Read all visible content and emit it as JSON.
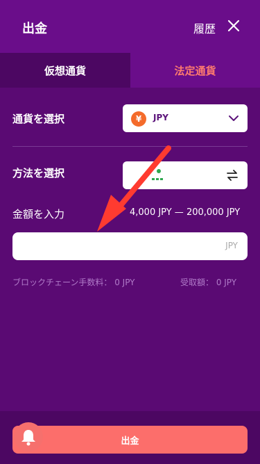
{
  "header": {
    "title": "出金",
    "history_label": "履歴"
  },
  "tabs": [
    {
      "label": "仮想通貨",
      "active": true
    },
    {
      "label": "法定通貨",
      "active": false
    }
  ],
  "currency": {
    "label": "通貨を選択",
    "selected": "JPY",
    "symbol": "¥"
  },
  "method": {
    "label": "方法を選択"
  },
  "amount": {
    "label": "金額を入力",
    "range": "4,000 JPY — 200,000 JPY",
    "unit": "JPY",
    "value": ""
  },
  "fees": {
    "blockchain_fee": "ブロックチェーン手数料： 0 JPY",
    "received": "受取額： 0 JPY"
  },
  "actions": {
    "withdraw_label": "出金"
  },
  "colors": {
    "background": "#5a0a73",
    "header": "#6a0d8a",
    "accent": "#fc6e6b",
    "tab_active_text": "#ff7b6e",
    "arrow": "#ff3b30"
  }
}
